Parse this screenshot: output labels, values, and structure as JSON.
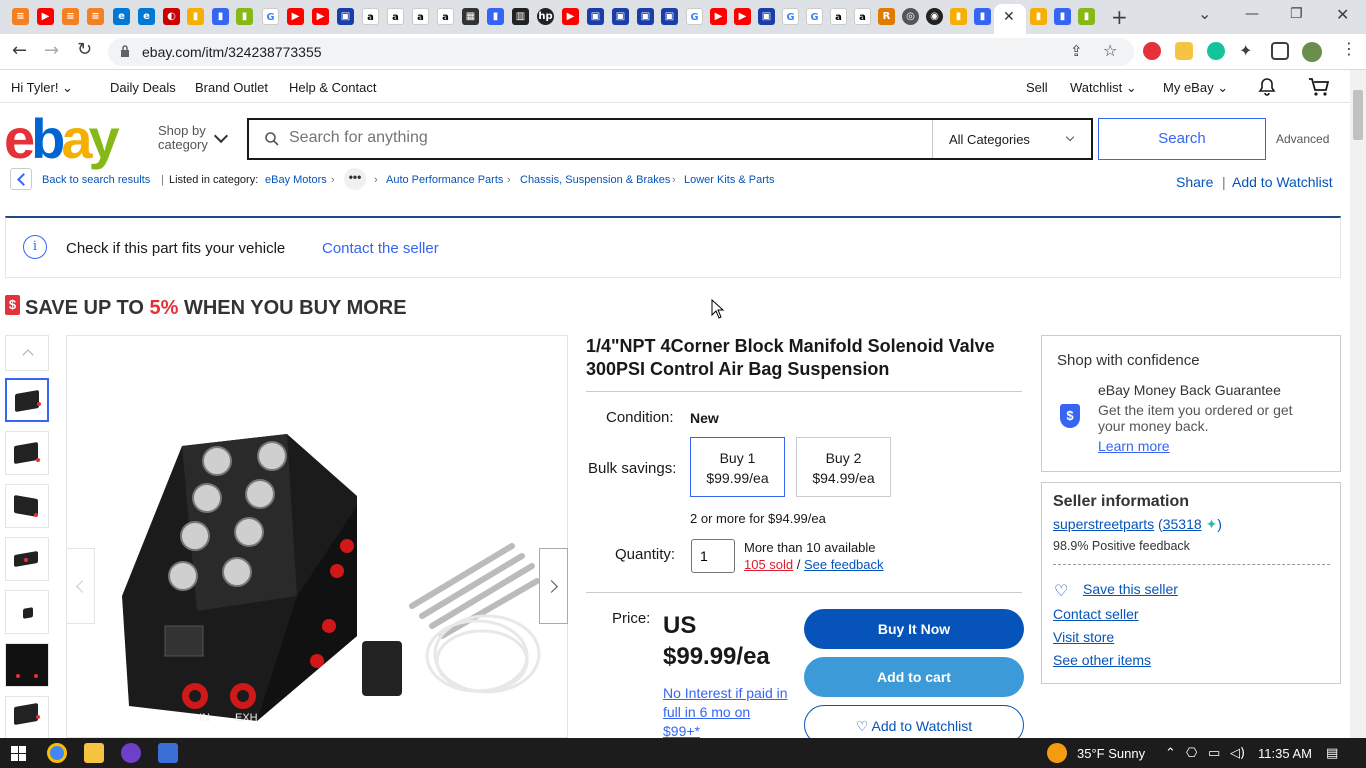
{
  "browser": {
    "active_tab_close": "✕",
    "new_tab": "+",
    "url": "ebay.com/itm/324238773355",
    "tabs_minimize": "⌄"
  },
  "header": {
    "greeting": "Hi Tyler!",
    "daily_deals": "Daily Deals",
    "brand_outlet": "Brand Outlet",
    "help_contact": "Help & Contact",
    "sell": "Sell",
    "watchlist": "Watchlist",
    "my_ebay": "My eBay",
    "logo": {
      "e": "e",
      "b": "b",
      "a": "a",
      "y": "y"
    },
    "shop_by": "Shop by",
    "category": "category",
    "search_placeholder": "Search for anything",
    "all_categories": "All Categories",
    "search_button": "Search",
    "advanced": "Advanced"
  },
  "breadcrumb": {
    "back": "Back to search results",
    "listed_in": "Listed in category:",
    "items": [
      "eBay Motors",
      "Auto Performance Parts",
      "Chassis, Suspension & Brakes",
      "Lower Kits & Parts"
    ],
    "more": "•••",
    "share": "Share",
    "add_watchlist": "Add to Watchlist"
  },
  "fitment": {
    "text": "Check if this part fits your vehicle",
    "contact": "Contact the seller"
  },
  "promo": {
    "prefix": "SAVE UP TO ",
    "percent": "5%",
    "suffix": " WHEN YOU BUY MORE"
  },
  "item": {
    "title": "1/4\"NPT 4Corner Block Manifold Solenoid Valve 300PSI Control Air Bag Suspension",
    "condition_label": "Condition:",
    "condition_value": "New",
    "bulk_label": "Bulk savings:",
    "bulk_options": [
      {
        "qty": "Buy 1",
        "price": "$99.99/ea"
      },
      {
        "qty": "Buy 2",
        "price": "$94.99/ea"
      }
    ],
    "bulk_note": "2 or more for $94.99/ea",
    "quantity_label": "Quantity:",
    "quantity_value": "1",
    "available": "More than 10 available",
    "sold": "105 sold",
    "sold_sep": " / ",
    "see_feedback": "See feedback",
    "price_label": "Price:",
    "price_currency": "US",
    "price_value": "$99.99/ea",
    "no_interest": "No Interest if paid in full in 6 mo on $99+*",
    "buy_now": "Buy It Now",
    "add_to_cart": "Add to cart",
    "add_to_watchlist": "♡ Add to Watchlist"
  },
  "confidence": {
    "title": "Shop with confidence",
    "guarantee": "eBay Money Back Guarantee",
    "guarantee_desc": "Get the item you ordered or get your money back.",
    "learn_more": "Learn more"
  },
  "seller": {
    "title": "Seller information",
    "name": "superstreetparts",
    "score": "35318",
    "positive": "98.9% Positive feedback",
    "save": "Save this seller",
    "contact": "Contact seller",
    "visit": "Visit store",
    "other": "See other items"
  },
  "taskbar": {
    "weather": "35°F  Sunny",
    "time": "11:35 AM"
  }
}
